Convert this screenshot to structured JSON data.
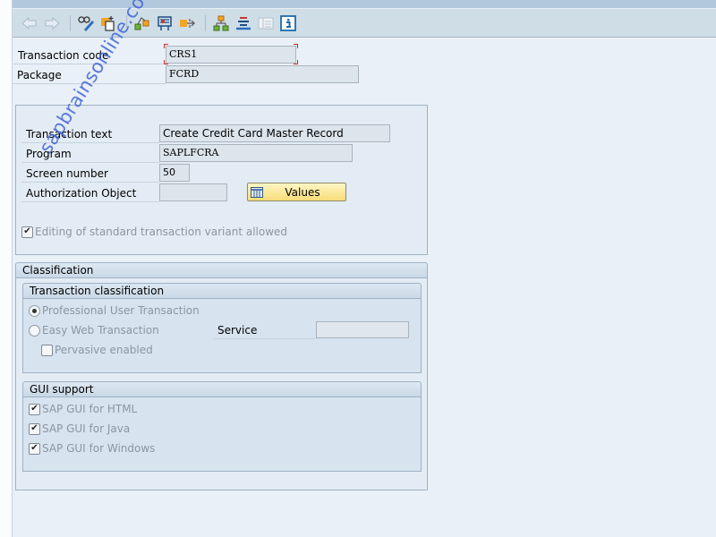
{
  "toolbar": {
    "buttons": [
      {
        "name": "back-arrow-icon",
        "enabled": false
      },
      {
        "name": "forward-arrow-icon",
        "enabled": false
      },
      {
        "name": "display-change-icon",
        "enabled": true
      },
      {
        "name": "other-object-icon",
        "enabled": true
      },
      {
        "name": "check-icon",
        "enabled": true
      },
      {
        "name": "activate-icon",
        "enabled": true
      },
      {
        "name": "where-used-icon",
        "enabled": true
      },
      {
        "name": "object-list-icon",
        "enabled": true
      },
      {
        "name": "navigation-stack-icon",
        "enabled": true
      },
      {
        "name": "display-window-icon",
        "enabled": false
      },
      {
        "name": "information-icon",
        "enabled": true
      }
    ]
  },
  "header": {
    "transaction_code_label": "Transaction code",
    "transaction_code_value": "CRS1",
    "package_label": "Package",
    "package_value": "FCRD"
  },
  "details": {
    "transaction_text_label": "Transaction text",
    "transaction_text_value": "Create Credit Card Master Record",
    "program_label": "Program",
    "program_value": "SAPLFCRA",
    "screen_number_label": "Screen number",
    "screen_number_value": "50",
    "auth_object_label": "Authorization Object",
    "auth_object_value": "",
    "values_button_label": "Values",
    "editing_variant_label": "Editing of standard transaction variant allowed",
    "editing_variant_checked": true
  },
  "classification": {
    "title": "Classification",
    "transaction_classification": {
      "title": "Transaction classification",
      "options": [
        {
          "label": "Professional User Transaction",
          "selected": true
        },
        {
          "label": "Easy Web Transaction",
          "selected": false
        }
      ],
      "service_label": "Service",
      "service_value": "",
      "pervasive_label": "Pervasive enabled",
      "pervasive_checked": false
    },
    "gui_support": {
      "title": "GUI support",
      "items": [
        {
          "label": "SAP GUI for HTML",
          "checked": true
        },
        {
          "label": "SAP GUI for Java",
          "checked": true
        },
        {
          "label": "SAP GUI for Windows",
          "checked": true
        }
      ]
    }
  },
  "watermark": "sapbrainsonline.com",
  "colors": {
    "values_button": "#f8dc77",
    "required_marker": "#c2302a",
    "watermark": "#3f63d8"
  }
}
